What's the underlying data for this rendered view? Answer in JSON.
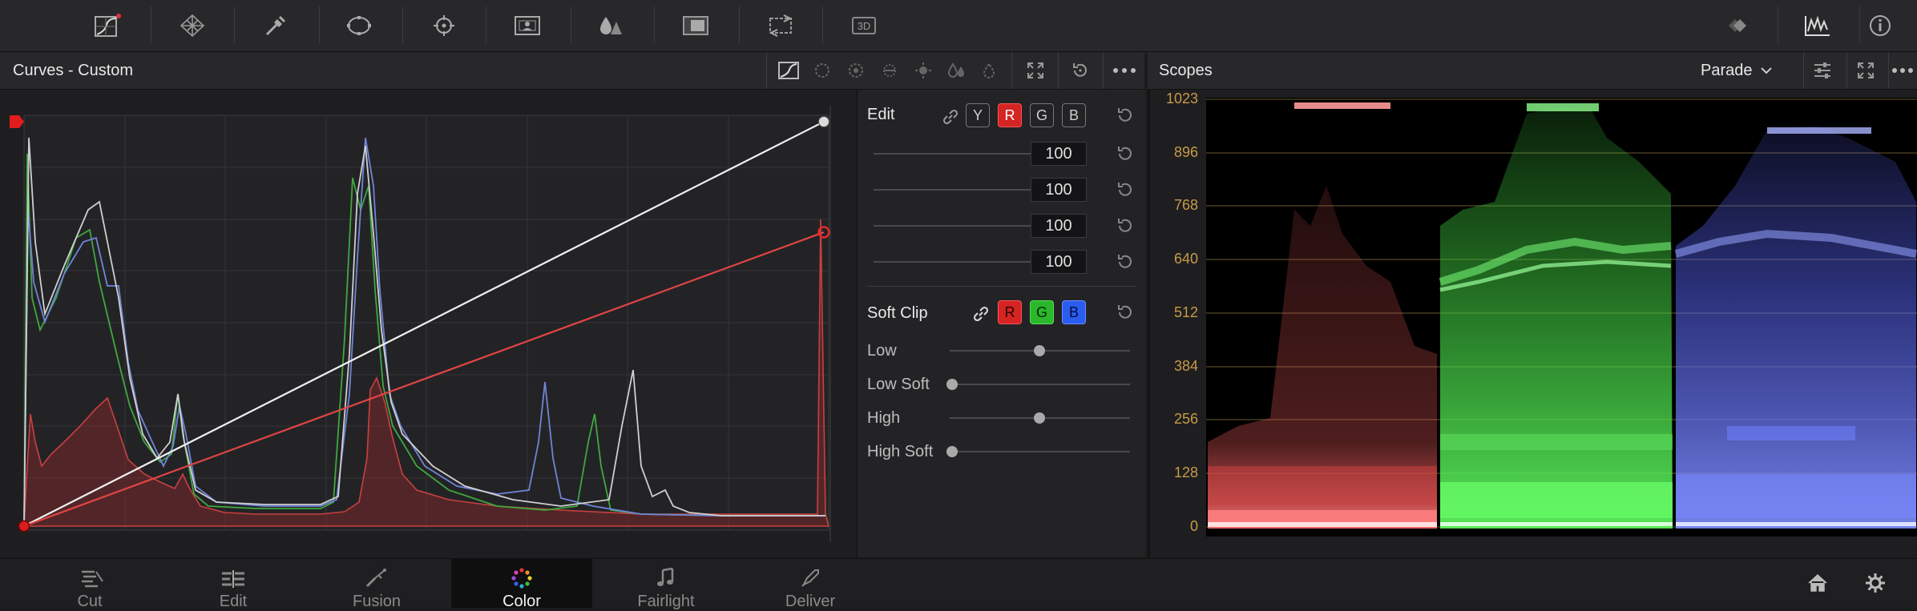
{
  "toolbar": {
    "left_tools": [
      "curves-icon",
      "color-warper-icon",
      "qualifier-icon",
      "window-icon",
      "tracker-icon",
      "magic-mask-icon",
      "blur-icon",
      "key-icon",
      "sizing-icon",
      "3d-icon"
    ],
    "tool_3d_label": "3D",
    "right_tools": [
      "keyframes-icon",
      "scopes-icon",
      "info-icon"
    ]
  },
  "curves": {
    "title": "Curves - Custom"
  },
  "scopes": {
    "title": "Scopes",
    "mode": "Parade",
    "y_labels": [
      "1023",
      "896",
      "768",
      "640",
      "512",
      "384",
      "256",
      "128",
      "0"
    ]
  },
  "edit": {
    "label": "Edit",
    "channels": [
      "Y",
      "R",
      "G",
      "B"
    ],
    "sliders": [
      {
        "channel": "white",
        "value": "100",
        "color": "#dcdcdc"
      },
      {
        "channel": "red",
        "value": "100",
        "color": "#d42424"
      },
      {
        "channel": "green",
        "value": "100",
        "color": "#2cb62c"
      },
      {
        "channel": "blue",
        "value": "100",
        "color": "#2b5cf0"
      }
    ]
  },
  "soft_clip": {
    "label": "Soft Clip",
    "channels": [
      "R",
      "G",
      "B"
    ],
    "rows": [
      {
        "label": "Low",
        "level": 0.5
      },
      {
        "label": "Low Soft",
        "level": 0.0
      },
      {
        "label": "High",
        "level": 0.5
      },
      {
        "label": "High Soft",
        "level": 0.0
      }
    ]
  },
  "pages": [
    {
      "label": "Cut",
      "icon": "cut-page-icon",
      "active": false
    },
    {
      "label": "Edit",
      "icon": "edit-page-icon",
      "active": false
    },
    {
      "label": "Fusion",
      "icon": "fusion-page-icon",
      "active": false
    },
    {
      "label": "Color",
      "icon": "color-page-icon",
      "active": true
    },
    {
      "label": "Fairlight",
      "icon": "fairlight-page-icon",
      "active": false
    },
    {
      "label": "Deliver",
      "icon": "deliver-page-icon",
      "active": false
    }
  ],
  "colors": {
    "accent_red": "#d42424",
    "accent_green": "#2cb62c",
    "accent_blue": "#2b5cf0",
    "scope_grid": "#7a6a3c",
    "scope_label": "#c89a48"
  }
}
